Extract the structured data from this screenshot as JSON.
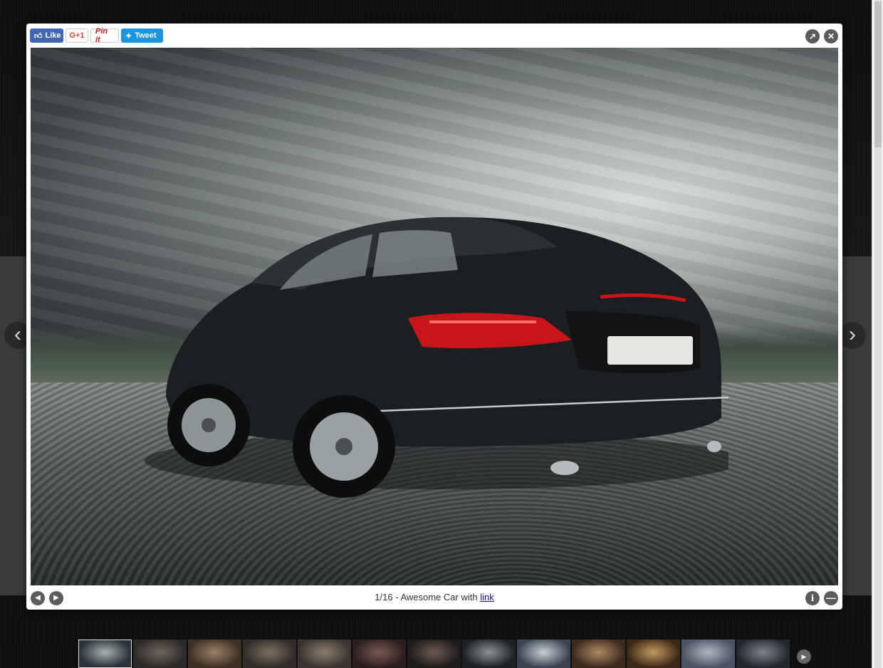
{
  "social": {
    "like_label": "Like",
    "gplus_label": "G+1",
    "pin_label": "Pin it",
    "tweet_label": "Tweet"
  },
  "caption": {
    "counter": "1/16",
    "separator": " - ",
    "text": "Awesome Car with ",
    "link_text": "link"
  },
  "icons": {
    "expand": "expand-icon",
    "close": "close-icon",
    "prev": "prev-icon",
    "next": "next-icon",
    "info": "info-icon",
    "minimize": "minimize-icon"
  },
  "colors": {
    "facebook": "#4267b2",
    "twitter": "#1b95e0",
    "pinterest": "#cb2027",
    "gplus": "#dd4b39",
    "link": "#1a0dab"
  },
  "thumbnails": [
    {
      "name": "car-1",
      "tone": "#2b3238",
      "tone2": "#a9b0b0"
    },
    {
      "name": "man-hat",
      "tone": "#2c2a28",
      "tone2": "#6e655c"
    },
    {
      "name": "woman-coat",
      "tone": "#3d2f24",
      "tone2": "#9a8066"
    },
    {
      "name": "man-sitting",
      "tone": "#2f2c28",
      "tone2": "#7d6f5e"
    },
    {
      "name": "man-portrait",
      "tone": "#3a3530",
      "tone2": "#8b7d6c"
    },
    {
      "name": "woman-red",
      "tone": "#2b1e1e",
      "tone2": "#7a5a52"
    },
    {
      "name": "woman-dark",
      "tone": "#1e1b1b",
      "tone2": "#6e5a50"
    },
    {
      "name": "car-2",
      "tone": "#1d2124",
      "tone2": "#8b9294"
    },
    {
      "name": "woman-hat",
      "tone": "#3a4350",
      "tone2": "#c9cfd6"
    },
    {
      "name": "woman-blonde",
      "tone": "#3b2a1e",
      "tone2": "#b08a62"
    },
    {
      "name": "woman-fur",
      "tone": "#3c2816",
      "tone2": "#c29a62"
    },
    {
      "name": "man-winter",
      "tone": "#4a5462",
      "tone2": "#aeb6c2"
    },
    {
      "name": "woman-portrait",
      "tone": "#22272c",
      "tone2": "#7c858c"
    }
  ]
}
